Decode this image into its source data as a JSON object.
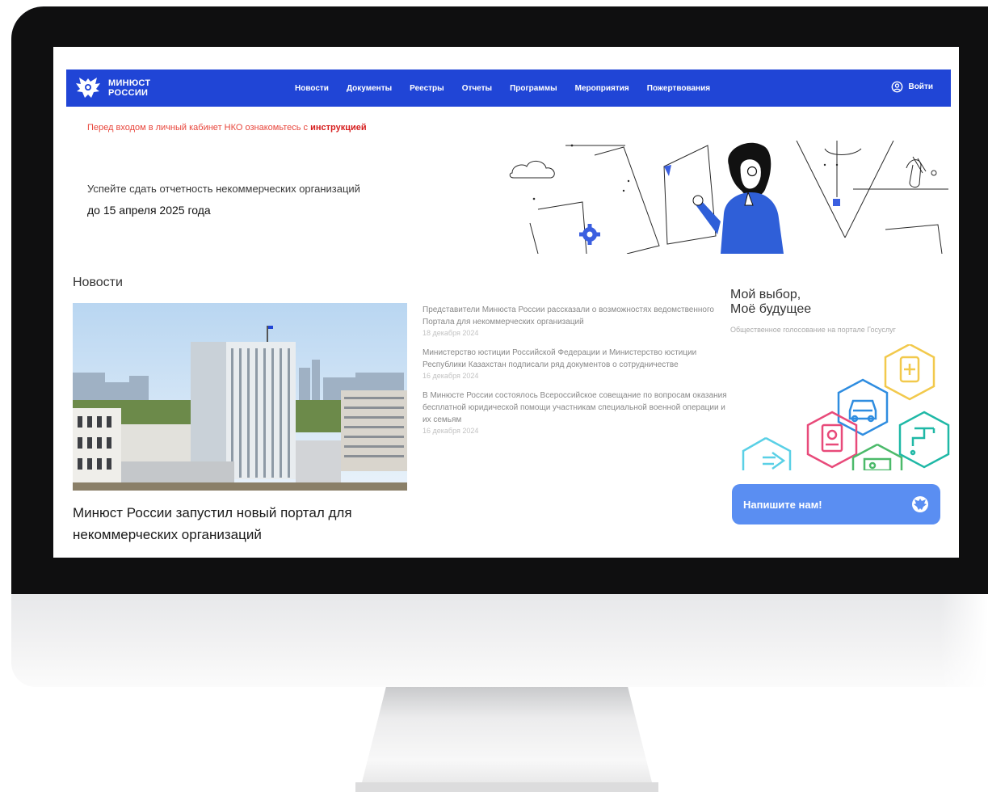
{
  "header": {
    "logo_line1": "МИНЮСТ",
    "logo_line2": "РОССИИ",
    "logo_icon": "eagle-emblem-icon",
    "nav": [
      {
        "label": "Новости"
      },
      {
        "label": "Документы"
      },
      {
        "label": "Реестры"
      },
      {
        "label": "Отчеты"
      },
      {
        "label": "Программы"
      },
      {
        "label": "Мероприятия"
      },
      {
        "label": "Пожертвования"
      }
    ],
    "login_label": "Войти",
    "login_icon": "user-circle-icon"
  },
  "notice": {
    "text": "Перед входом в личный кабинет НКО ознакомьтесь с ",
    "link": "инструкцией"
  },
  "banner": {
    "line1": "Успейте сдать отчетность некоммерческих организаций",
    "line2": "до 15 апреля 2025 года"
  },
  "news": {
    "heading": "Новости",
    "main_title": "Минюст России запустил новый портал для некоммерческих организаций",
    "items": [
      {
        "text": "Представители Минюста России рассказали о возможностях ведомственного Портала для некоммерческих организаций",
        "date": "18 декабря 2024"
      },
      {
        "text": "Министерство юстиции Российской Федерации и Министерство юстиции Республики Казахстан подписали ряд документов о сотрудничестве",
        "date": "16 декабря 2024"
      },
      {
        "text": "В Минюсте России состоялось Всероссийское совещание по вопросам оказания бесплатной юридической помощи участникам специальной военной операции и их семьям",
        "date": "16 декабря 2024"
      }
    ]
  },
  "promo": {
    "title_line1": "Мой выбор,",
    "title_line2": "Моё будущее",
    "subtitle": "Общественное голосование на портале Госуслуг"
  },
  "chat": {
    "label": "Напишите нам!",
    "icon": "emblem-icon"
  },
  "colors": {
    "brand_blue": "#2045d6",
    "notice_red": "#e8463c",
    "chat_blue": "#5a8ef2"
  }
}
